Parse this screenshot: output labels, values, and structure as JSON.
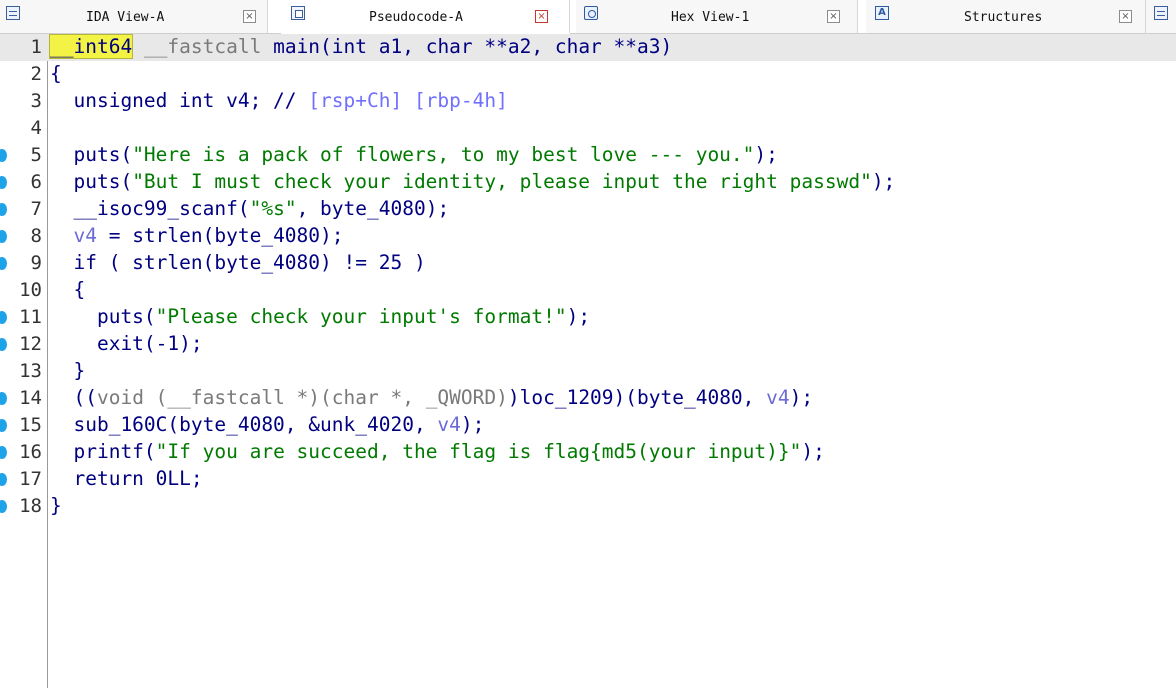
{
  "tabs": [
    {
      "label": "IDA View-A",
      "icon": "disassembly-icon",
      "active": false,
      "close": "×"
    },
    {
      "label": "Pseudocode-A",
      "icon": "pseudocode-icon",
      "active": true,
      "close": "×"
    },
    {
      "label": "Hex View-1",
      "icon": "hex-view-icon",
      "active": false,
      "close": "×"
    },
    {
      "label": "Structures",
      "icon": "structures-icon",
      "active": false,
      "close": "×"
    }
  ],
  "structures_icon_glyph": "A",
  "colors": {
    "keyword": "#000080",
    "string": "#007a00",
    "comment": "#7070ff",
    "variable": "#6b6bd6",
    "cursor_highlight": "#f3f345",
    "breakpoint": "#1fa3e8"
  },
  "code": {
    "lines": [
      {
        "n": "1",
        "bp": false,
        "tokens": [
          [
            "cursor",
            "__int64"
          ],
          [
            "gray",
            " __fastcall "
          ],
          [
            "id",
            "main(int a1, char **a2, char **a3)"
          ]
        ]
      },
      {
        "n": "2",
        "bp": false,
        "tokens": [
          [
            "punc",
            "{"
          ]
        ]
      },
      {
        "n": "3",
        "bp": false,
        "tokens": [
          [
            "id",
            "  unsigned int v4; // "
          ],
          [
            "cmt",
            "[rsp+Ch] [rbp-4h]"
          ]
        ]
      },
      {
        "n": "4",
        "bp": false,
        "tokens": []
      },
      {
        "n": "5",
        "bp": true,
        "tokens": [
          [
            "id",
            "  puts("
          ],
          [
            "str",
            "\"Here is a pack of flowers, to my best love --- you.\""
          ],
          [
            "id",
            ");"
          ]
        ]
      },
      {
        "n": "6",
        "bp": true,
        "tokens": [
          [
            "id",
            "  puts("
          ],
          [
            "str",
            "\"But I must check your identity, please input the right passwd\""
          ],
          [
            "id",
            ");"
          ]
        ]
      },
      {
        "n": "7",
        "bp": true,
        "tokens": [
          [
            "id",
            "  __isoc99_scanf("
          ],
          [
            "str",
            "\"%s\""
          ],
          [
            "id",
            ", byte_4080);"
          ]
        ]
      },
      {
        "n": "8",
        "bp": true,
        "tokens": [
          [
            "id",
            "  "
          ],
          [
            "var",
            "v4"
          ],
          [
            "id",
            " = strlen(byte_4080);"
          ]
        ]
      },
      {
        "n": "9",
        "bp": true,
        "tokens": [
          [
            "id",
            "  if ( strlen(byte_4080) != 25 )"
          ]
        ]
      },
      {
        "n": "10",
        "bp": false,
        "tokens": [
          [
            "id",
            "  {"
          ]
        ]
      },
      {
        "n": "11",
        "bp": true,
        "tokens": [
          [
            "id",
            "    puts("
          ],
          [
            "str",
            "\"Please check your input's format!\""
          ],
          [
            "id",
            ");"
          ]
        ]
      },
      {
        "n": "12",
        "bp": true,
        "tokens": [
          [
            "id",
            "    exit(-1);"
          ]
        ]
      },
      {
        "n": "13",
        "bp": false,
        "tokens": [
          [
            "id",
            "  }"
          ]
        ]
      },
      {
        "n": "14",
        "bp": true,
        "tokens": [
          [
            "id",
            "  (("
          ],
          [
            "gray",
            "void (__fastcall *)(char *, _QWORD)"
          ],
          [
            "id",
            ")loc_1209)(byte_4080, "
          ],
          [
            "var",
            "v4"
          ],
          [
            "id",
            ");"
          ]
        ]
      },
      {
        "n": "15",
        "bp": true,
        "tokens": [
          [
            "id",
            "  sub_160C(byte_4080, &unk_4020, "
          ],
          [
            "var",
            "v4"
          ],
          [
            "id",
            ");"
          ]
        ]
      },
      {
        "n": "16",
        "bp": true,
        "tokens": [
          [
            "id",
            "  printf("
          ],
          [
            "str",
            "\"If you are succeed, the flag is flag{md5(your input)}\""
          ],
          [
            "id",
            ");"
          ]
        ]
      },
      {
        "n": "17",
        "bp": true,
        "tokens": [
          [
            "id",
            "  return 0LL;"
          ]
        ]
      },
      {
        "n": "18",
        "bp": true,
        "tokens": [
          [
            "punc",
            "}"
          ]
        ]
      }
    ]
  }
}
